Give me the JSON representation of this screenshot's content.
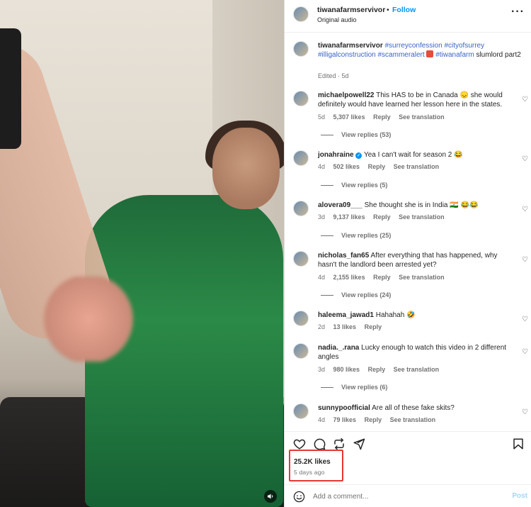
{
  "post": {
    "username": "tiwanafarmservivor",
    "separator": "•",
    "follow_label": "Follow",
    "audio": "Original audio",
    "more_icon": "more-icon"
  },
  "caption": {
    "username": "tiwanafarmservivor",
    "tags": [
      "#surreyconfession",
      "#cityofsurrey",
      "#illigalconstruction",
      "#scammeralert",
      "#tiwanafarm"
    ],
    "tail": "slumlord part2",
    "edited": "Edited · 5d"
  },
  "comments": [
    {
      "user": "michaelpowell22",
      "text": "This HAS to be in Canada 😞 she would definitely would have learned her lesson here in the states.",
      "age": "5d",
      "likes": "5,307 likes",
      "reply": "Reply",
      "translate": "See translation",
      "view_replies": "View replies (53)"
    },
    {
      "user": "jonahraine",
      "verified": true,
      "text": "Yea I can't wait for season 2 😂",
      "age": "4d",
      "likes": "502 likes",
      "reply": "Reply",
      "translate": "See translation",
      "view_replies": "View replies (5)"
    },
    {
      "user": "alovera09___",
      "text": "She thought she is in India 🇮🇳 😂😂",
      "age": "3d",
      "likes": "9,137 likes",
      "reply": "Reply",
      "translate": "See translation",
      "view_replies": "View replies (25)"
    },
    {
      "user": "nicholas_fan65",
      "text": "After everything that has happened, why hasn't the landlord been arrested yet?",
      "age": "4d",
      "likes": "2,155 likes",
      "reply": "Reply",
      "translate": "See translation",
      "view_replies": "View replies (24)"
    },
    {
      "user": "haleema_jawad1",
      "text": "Hahahah 🤣",
      "age": "2d",
      "likes": "13 likes",
      "reply": "Reply"
    },
    {
      "user": "nadia._.rana",
      "text": "Lucky enough to watch this video in 2 different angles",
      "age": "3d",
      "likes": "980 likes",
      "reply": "Reply",
      "translate": "See translation",
      "view_replies": "View replies (6)"
    },
    {
      "user": "sunnypoofficial",
      "text": "Are all of these fake skits?",
      "age": "4d",
      "likes": "79 likes",
      "reply": "Reply",
      "translate": "See translation"
    }
  ],
  "stats": {
    "likes": "25.2K likes",
    "ago": "5 days ago"
  },
  "composer": {
    "placeholder": "Add a comment...",
    "post_label": "Post"
  },
  "colors": {
    "accent": "#0095f6",
    "highlight_box": "#e53935",
    "hashtag": "#3865c8"
  }
}
